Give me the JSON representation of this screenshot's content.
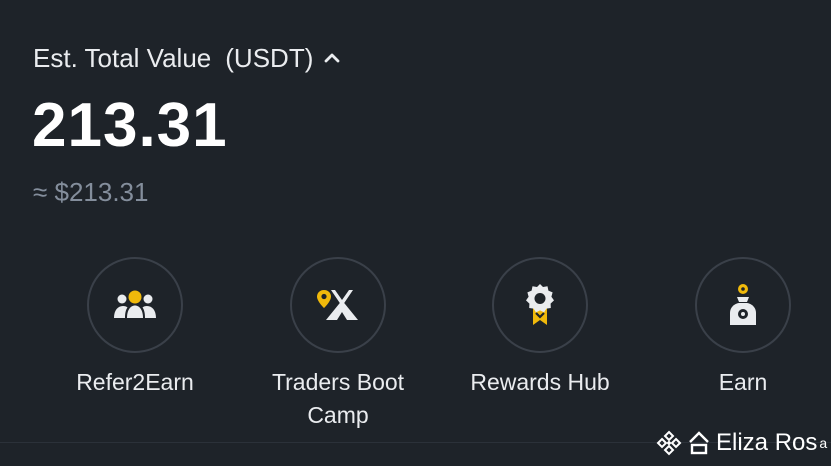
{
  "balance": {
    "label": "Est. Total Value",
    "currency": "(USDT)",
    "value": "213.31",
    "fiat_value": "≈ $213.31"
  },
  "actions": [
    {
      "label": "Refer2Earn",
      "icon": "refer-users-icon"
    },
    {
      "label": "Traders Boot Camp",
      "icon": "tent-icon"
    },
    {
      "label": "Rewards Hub",
      "icon": "reward-medal-icon"
    },
    {
      "label": "Earn",
      "icon": "earn-bag-icon"
    }
  ],
  "watermark": {
    "text": "Eliza Ros",
    "badge": "a"
  },
  "colors": {
    "background": "#1e2329",
    "accent": "#f0b90b",
    "text_primary": "#eaecef",
    "text_secondary": "#848e9c"
  }
}
